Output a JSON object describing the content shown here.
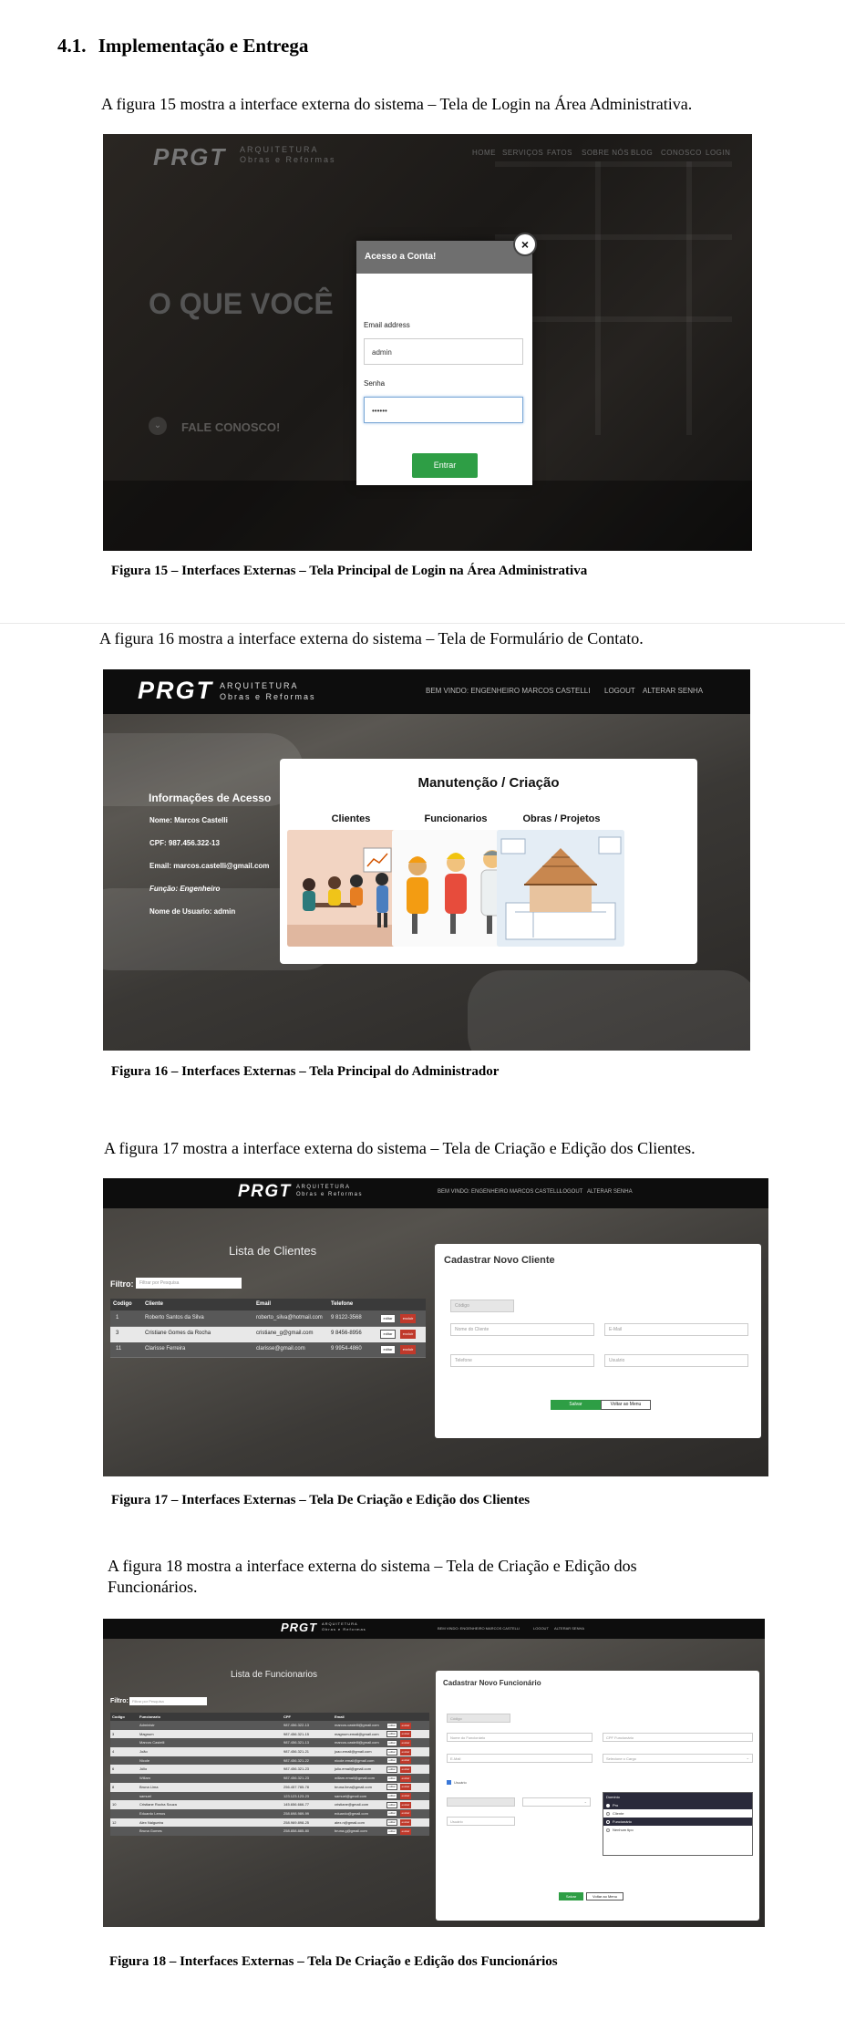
{
  "section": {
    "number": "4.1.",
    "title": "Implementação e Entrega"
  },
  "figures": [
    {
      "intro": "A figura 15 mostra a interface externa do sistema – Tela de Login na Área Administrativa.",
      "caption": "Figura 15 – Interfaces Externas – Tela Principal de Login na Área Administrativa",
      "screenshot": {
        "logo": "PRGT",
        "logo_line1": "ARQUITETURA",
        "logo_line2": "Obras e Reformas",
        "nav": [
          "HOME",
          "SERVIÇOS",
          "FATOS",
          "SOBRE NÓS",
          "BLOG",
          "CONOSCO",
          "LOGIN"
        ],
        "hero_text": "O QUE VOCÊ",
        "cta": "FALE CONOSCO!",
        "modal": {
          "title": "Acesso a Conta!",
          "close": "×",
          "email_label": "Email address",
          "email_value": "admin",
          "password_label": "Senha",
          "password_value": "••••••",
          "submit": "Entrar"
        }
      }
    },
    {
      "intro": "A figura 16 mostra a interface externa do sistema – Tela de Formulário de Contato.",
      "caption": "Figura 16 – Interfaces Externas – Tela Principal do Administrador",
      "screenshot": {
        "logo": "PRGT",
        "logo_line1": "ARQUITETURA",
        "logo_line2": "Obras e Reformas",
        "nav": [
          "BEM VINDO:  ENGENHEIRO  MARCOS CASTELLI",
          "LOGOUT",
          "ALTERAR SENHA"
        ],
        "info": {
          "title": "Informações de Acesso",
          "lines": [
            "Nome: Marcos Castelli",
            "CPF: 987.456.322-13",
            "Email: marcos.castelli@gmail.com",
            "Função: Engenheiro",
            "Nome de Usuario: admin"
          ]
        },
        "panel": {
          "title": "Manutenção / Criação",
          "cards": [
            "Clientes",
            "Funcionarios",
            "Obras / Projetos"
          ]
        }
      }
    },
    {
      "intro": "A figura 17 mostra a interface externa do sistema – Tela de Criação e Edição dos Clientes.",
      "caption": "Figura 17 – Interfaces Externas – Tela De Criação e Edição dos Clientes",
      "screenshot": {
        "logo": "PRGT",
        "logo_line1": "ARQUITETURA",
        "logo_line2": "Obras e Reformas",
        "nav": [
          "BEM VINDO:  ENGENHEIRO  MARCOS CASTELLI",
          "LOGOUT",
          "ALTERAR SENHA"
        ],
        "list_title": "Lista de Clientes",
        "filter_label": "Filtro:",
        "filter_placeholder": "Filtrar por Pesquisa",
        "columns": [
          "Codigo",
          "Cliente",
          "Email",
          "Telefone"
        ],
        "rows": [
          [
            "1",
            "Roberto Santos da Silva",
            "roberto_silva@hotmail.com",
            "9 8122-3568"
          ],
          [
            "3",
            "Cristiane Gomes da Rocha",
            "cristiane_g@gmail.com",
            "9 8456-8956"
          ],
          [
            "11",
            "Clarisse Ferreira",
            "clarisse@gmail.com",
            "9 9954-4860"
          ]
        ],
        "edit_label": "editar",
        "delete_label": "excluir",
        "form": {
          "title": "Cadastrar Novo Cliente",
          "code_placeholder": "Código",
          "name_placeholder": "Nome do Cliente",
          "email_placeholder": "E-Mail",
          "phone_placeholder": "Telefone",
          "user_placeholder": "Usuário",
          "save": "Salvar",
          "back": "Voltar ao Menu"
        }
      }
    },
    {
      "intro": "A figura 18 mostra a interface externa do sistema – Tela de Criação e Edição dos Funcionários.",
      "caption": "Figura 18 – Interfaces Externas – Tela De Criação e Edição dos Funcionários",
      "screenshot": {
        "logo": "PRGT",
        "logo_line1": "ARQUITETURA",
        "logo_line2": "Obras e Reformas",
        "nav": [
          "BEM VINDO:  ENGENHEIRO  MARCOS CASTELLI",
          "LOGOUT",
          "ALTERAR SENHA"
        ],
        "list_title": "Lista de Funcionarios",
        "filter_label": "Filtro:",
        "filter_placeholder": "Filtrar por Pesquisa",
        "columns": [
          "Codigo",
          "Funcionario",
          "CPF",
          "Email"
        ],
        "rows": [
          [
            "",
            "Administr",
            "987.456.322-13",
            "marcos.castelli@gmail.com"
          ],
          [
            "3",
            "Magnum",
            "987.456.321-15",
            "magnum.email@gmail.com"
          ],
          [
            "",
            "Marcos Castelli",
            "987.456.321-13",
            "marcos.castelli@gmail.com"
          ],
          [
            "4",
            "João",
            "987.456.321-21",
            "joao.email@gmail.com"
          ],
          [
            "",
            "Nicole",
            "987.456.321-22",
            "nicole.email@gmail.com"
          ],
          [
            "6",
            "Júlio",
            "987.456.321-23",
            "julio.email@gmail.com"
          ],
          [
            "",
            "Willam",
            "987.456.321-23",
            "willam.email@gmail.com"
          ],
          [
            "8",
            "Bruna Lima",
            "256.457.785-78",
            "bruna.lima@gmail.com"
          ],
          [
            "",
            "samuel",
            "123.123.123-23",
            "samuel@gmail.com"
          ],
          [
            "10",
            "Cristiane Rocha Souza",
            "145.656.666-77",
            "cristiane@gmail.com"
          ],
          [
            "",
            "Eduardo Lemos",
            "258.698.989-99",
            "eduardo@gmail.com"
          ],
          [
            "12",
            "Alex Nalgueira",
            "258.969.898-25",
            "alex.n@gmail.com"
          ],
          [
            "",
            "Bruna Gomes",
            "258.858.885-80",
            "bruna.g@gmail.com"
          ]
        ],
        "edit_label": "editar",
        "delete_label": "excluir",
        "form": {
          "title": "Cadastrar Novo Funcionário",
          "code_placeholder": "Código",
          "name_placeholder": "Nome do Funcionário",
          "cpf_placeholder": "CPF Funcionário",
          "email_placeholder": "E-Mail",
          "role_select": "Selecione o Cargo",
          "checkbox_label": "Usuário",
          "user_placeholder": "Usuário",
          "dropdown_header": "Domínio",
          "dropdown_options": [
            "Pro",
            "Cliente",
            "Funcionário",
            "Nenhum tipo"
          ],
          "save": "Salvar",
          "back": "Voltar ao Menu"
        }
      }
    }
  ]
}
